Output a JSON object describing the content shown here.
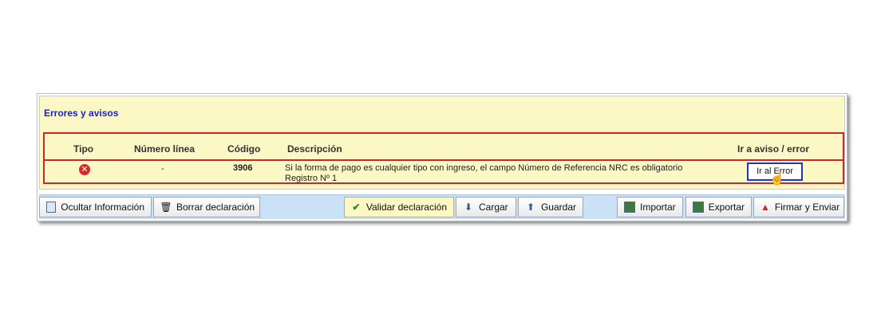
{
  "errors": {
    "title": "Errores y avisos",
    "headers": {
      "tipo": "Tipo",
      "numero_linea": "Número línea",
      "codigo": "Código",
      "descripcion": "Descripción",
      "ir_a": "Ir a aviso / error"
    },
    "row": {
      "tipo_icon": "error-circle-icon",
      "numero_linea": "-",
      "codigo": "3906",
      "descripcion_1": "Si la forma de pago es cualquier tipo con ingreso, el campo Número de Referencia NRC es obligatorio",
      "descripcion_2": "Registro Nº 1",
      "button": "Ir al Error"
    },
    "error_color": "#d2242b"
  },
  "toolbar": {
    "ocultar": "Ocultar Información",
    "borrar": "Borrar declaración",
    "validar": "Validar declaración",
    "cargar": "Cargar",
    "guardar": "Guardar",
    "importar": "Importar",
    "exportar": "Exportar",
    "firmar": "Firmar y Enviar",
    "bar_color": "#cbe1f5",
    "highlight_color": "#fbf8c5"
  }
}
